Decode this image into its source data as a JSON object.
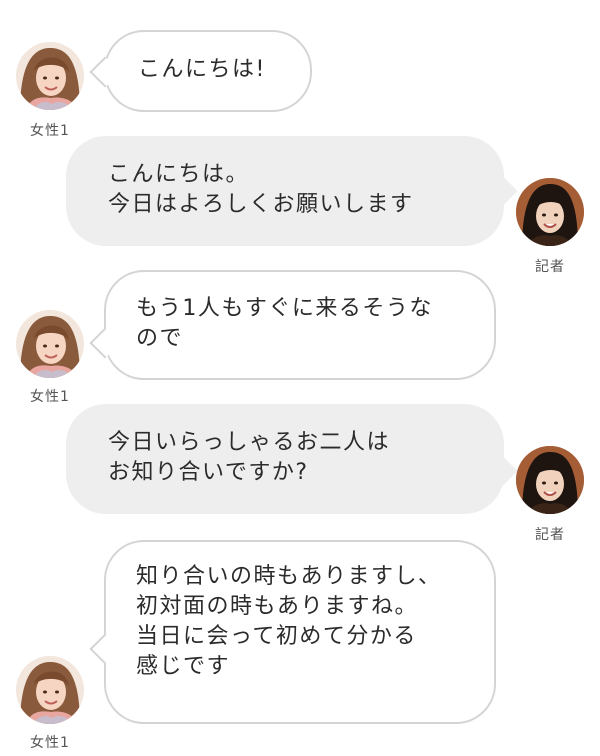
{
  "speakers": {
    "woman": {
      "name": "女性1",
      "avatar_icon": "woman-avatar-icon"
    },
    "reporter": {
      "name": "記者",
      "avatar_icon": "reporter-avatar-icon"
    }
  },
  "messages": [
    {
      "speaker": "女性1",
      "side": "left",
      "text": "こんにちは!"
    },
    {
      "speaker": "記者",
      "side": "right",
      "text": "こんにちは。\n今日はよろしくお願いします"
    },
    {
      "speaker": "女性1",
      "side": "left",
      "text": "もう1人もすぐに来るそうな\nので"
    },
    {
      "speaker": "記者",
      "side": "right",
      "text": "今日いらっしゃるお二人は\nお知り合いですか?"
    },
    {
      "speaker": "女性1",
      "side": "left",
      "text": "知り合いの時もありますし、\n初対面の時もありますね。\n当日に会って初めて分かる\n感じです"
    }
  ],
  "colors": {
    "left_bubble_bg": "#ffffff",
    "left_bubble_border": "#d4d4d4",
    "right_bubble_bg": "#eeeeee",
    "text": "#2b2b2b",
    "label": "#555555"
  }
}
